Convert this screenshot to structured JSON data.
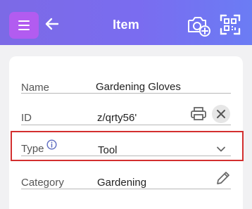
{
  "app_bar": {
    "title": "Item",
    "menu_icon": "hamburger-menu-icon",
    "back_icon": "arrow-left-icon",
    "camera_icon": "camera-add-icon",
    "scan_icon": "qr-scan-icon"
  },
  "form": {
    "name": {
      "label": "Name",
      "value": "Gardening Gloves"
    },
    "id": {
      "label": "ID",
      "value": "z/qrty56'",
      "print_icon": "printer-icon",
      "clear_icon": "close-circle-icon"
    },
    "type": {
      "label": "Type",
      "value": "Tool",
      "info_icon": "info-icon",
      "dropdown_icon": "chevron-down-icon"
    },
    "category": {
      "label": "Category",
      "value": "Gardening",
      "edit_icon": "pencil-icon"
    }
  },
  "colors": {
    "app_bar_start": "#7c6ae6",
    "app_bar_end": "#6b7cf4",
    "menu_button": "#b25cf0",
    "highlight_border": "#d32f2f"
  }
}
